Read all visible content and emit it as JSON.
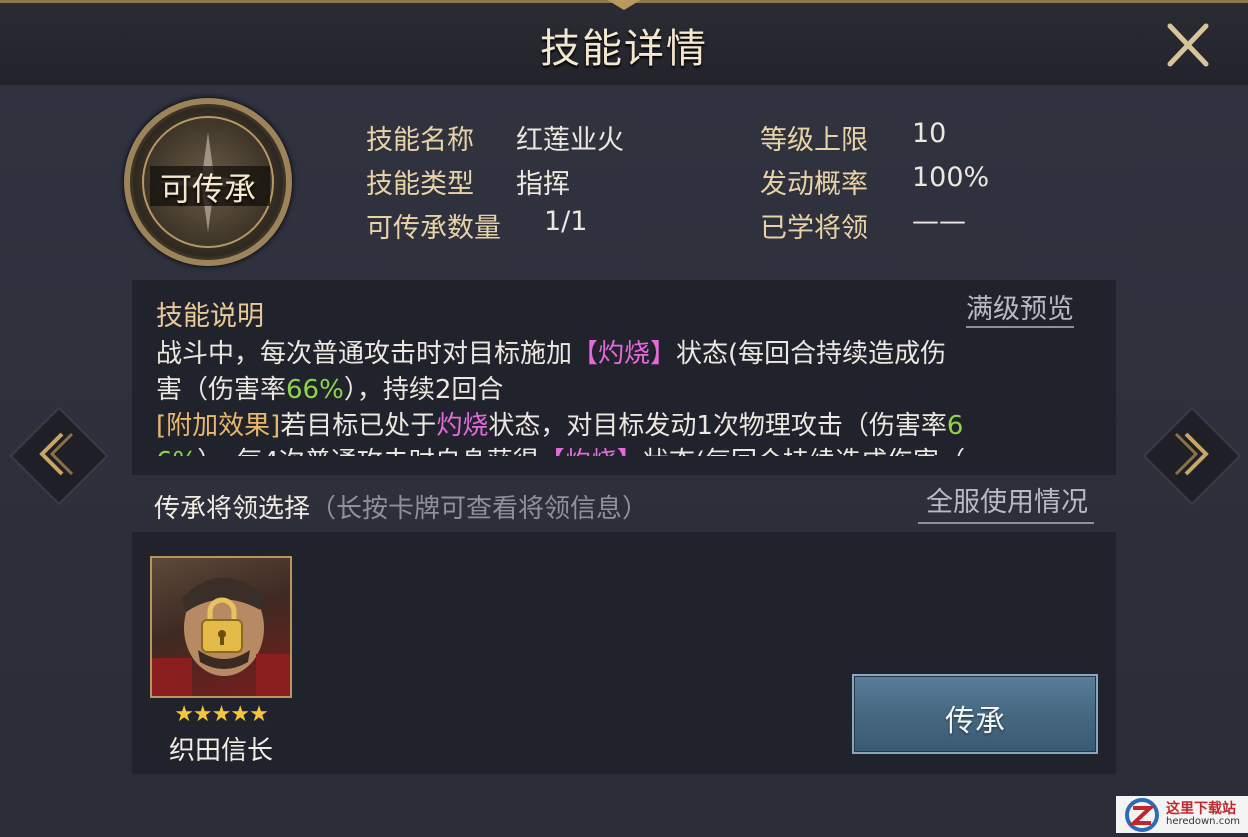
{
  "header": {
    "title": "技能详情"
  },
  "badge": {
    "label": "可传承"
  },
  "info": {
    "skill_name_label": "技能名称",
    "skill_name": "红莲业火",
    "skill_type_label": "技能类型",
    "skill_type": "指挥",
    "transfer_count_label": "可传承数量",
    "transfer_count": "1/1",
    "level_cap_label": "等级上限",
    "level_cap": "10",
    "trigger_rate_label": "发动概率",
    "trigger_rate": "100%",
    "learned_by_label": "已学将领",
    "learned_by": "——"
  },
  "description": {
    "title": "技能说明",
    "full_preview": "满级预览",
    "line1_a": "战斗中，每次普通攻击时对目标施加",
    "line1_tag": "【灼烧】",
    "line1_b": "状态(每回合持续造成伤",
    "line2_a": "害（伤害率",
    "line2_pct": "66%",
    "line2_b": "），持续2回合",
    "line3_tag": "[附加效果]",
    "line3_a": "若目标已处于",
    "line3_hl": "灼烧",
    "line3_b": "状态，对目标发动1次物理攻击（伤害率",
    "line3_pct": "6",
    "line4_pct": "6%",
    "line4_a": "），每4次普通攻击时自身获得",
    "line4_tag": "【灼烧】",
    "line4_b": "状态(每回合持续造成伤害（"
  },
  "selection": {
    "title": "传承将领选择",
    "hint": "（长按卡牌可查看将领信息）",
    "server_usage": "全服使用情况"
  },
  "general": {
    "name": "织田信长",
    "stars": "★★★★★"
  },
  "actions": {
    "inherit": "传承"
  },
  "watermark": {
    "line1": "这里下载站",
    "line2": "heredown.com"
  },
  "colors": {
    "accent_gold": "#e8b86a",
    "highlight_pink": "#e36ad9",
    "highlight_green": "#8fd34a",
    "button_blue": "#44677f"
  }
}
